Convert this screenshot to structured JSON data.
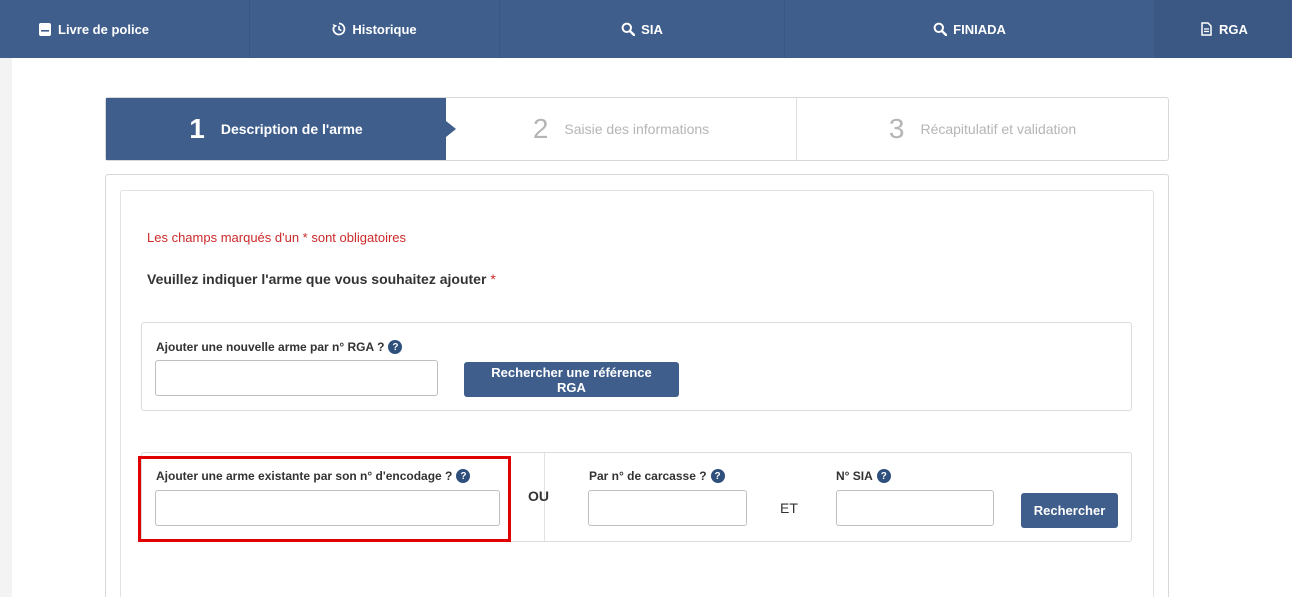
{
  "nav": {
    "items": [
      {
        "label": "Livre de police",
        "icon": "book-icon"
      },
      {
        "label": "Historique",
        "icon": "history-icon"
      },
      {
        "label": "SIA",
        "icon": "search-icon"
      },
      {
        "label": "FINIADA",
        "icon": "search-icon"
      },
      {
        "label": "RGA",
        "icon": "document-icon"
      }
    ]
  },
  "stepper": {
    "steps": [
      {
        "number": "1",
        "label": "Description de l'arme",
        "active": true
      },
      {
        "number": "2",
        "label": "Saisie des informations",
        "active": false
      },
      {
        "number": "3",
        "label": "Récapitulatif et validation",
        "active": false
      }
    ]
  },
  "form": {
    "required_note": "Les champs marqués d'un * sont obligatoires",
    "question": "Veuillez indiquer l'arme que vous souhaitez ajouter",
    "question_star": "*",
    "rga": {
      "label": "Ajouter une nouvelle arme par n° RGA ?",
      "value": "",
      "button": "Rechercher une référence RGA"
    },
    "encoding": {
      "label": "Ajouter une arme existante par son n° d'encodage ?",
      "value": ""
    },
    "or_word": "OU",
    "carcasse": {
      "label": "Par n° de carcasse ?",
      "value": ""
    },
    "and_word": "ET",
    "sia": {
      "label": "N° SIA",
      "value": ""
    },
    "search_button": "Rechercher",
    "help_glyph": "?"
  },
  "colors": {
    "primary": "#3f5e8c",
    "required": "#cc2a2a",
    "highlight": "#e00000"
  }
}
